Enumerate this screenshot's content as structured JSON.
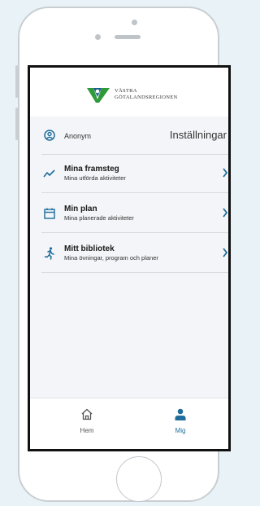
{
  "header": {
    "logo_line1": "VÄSTRA",
    "logo_line2": "GÖTALANDSREGIONEN"
  },
  "profile": {
    "name": "Anonym",
    "settings_label": "Inställningar"
  },
  "menu": [
    {
      "title": "Mina framsteg",
      "subtitle": "Mina utförda aktiviteter",
      "icon": "trend-line-icon"
    },
    {
      "title": "Min plan",
      "subtitle": "Mina planerade aktiviteter",
      "icon": "calendar-icon"
    },
    {
      "title": "Mitt bibliotek",
      "subtitle": "Mina övningar, program och planer",
      "icon": "running-person-icon"
    }
  ],
  "bottom_nav": [
    {
      "label": "Hem",
      "icon": "home-icon",
      "active": false
    },
    {
      "label": "Mig",
      "icon": "person-icon",
      "active": true
    }
  ],
  "colors": {
    "accent": "#1f6d9b",
    "brand_green": "#2f9a3a",
    "brand_blue": "#1c5e8c"
  }
}
